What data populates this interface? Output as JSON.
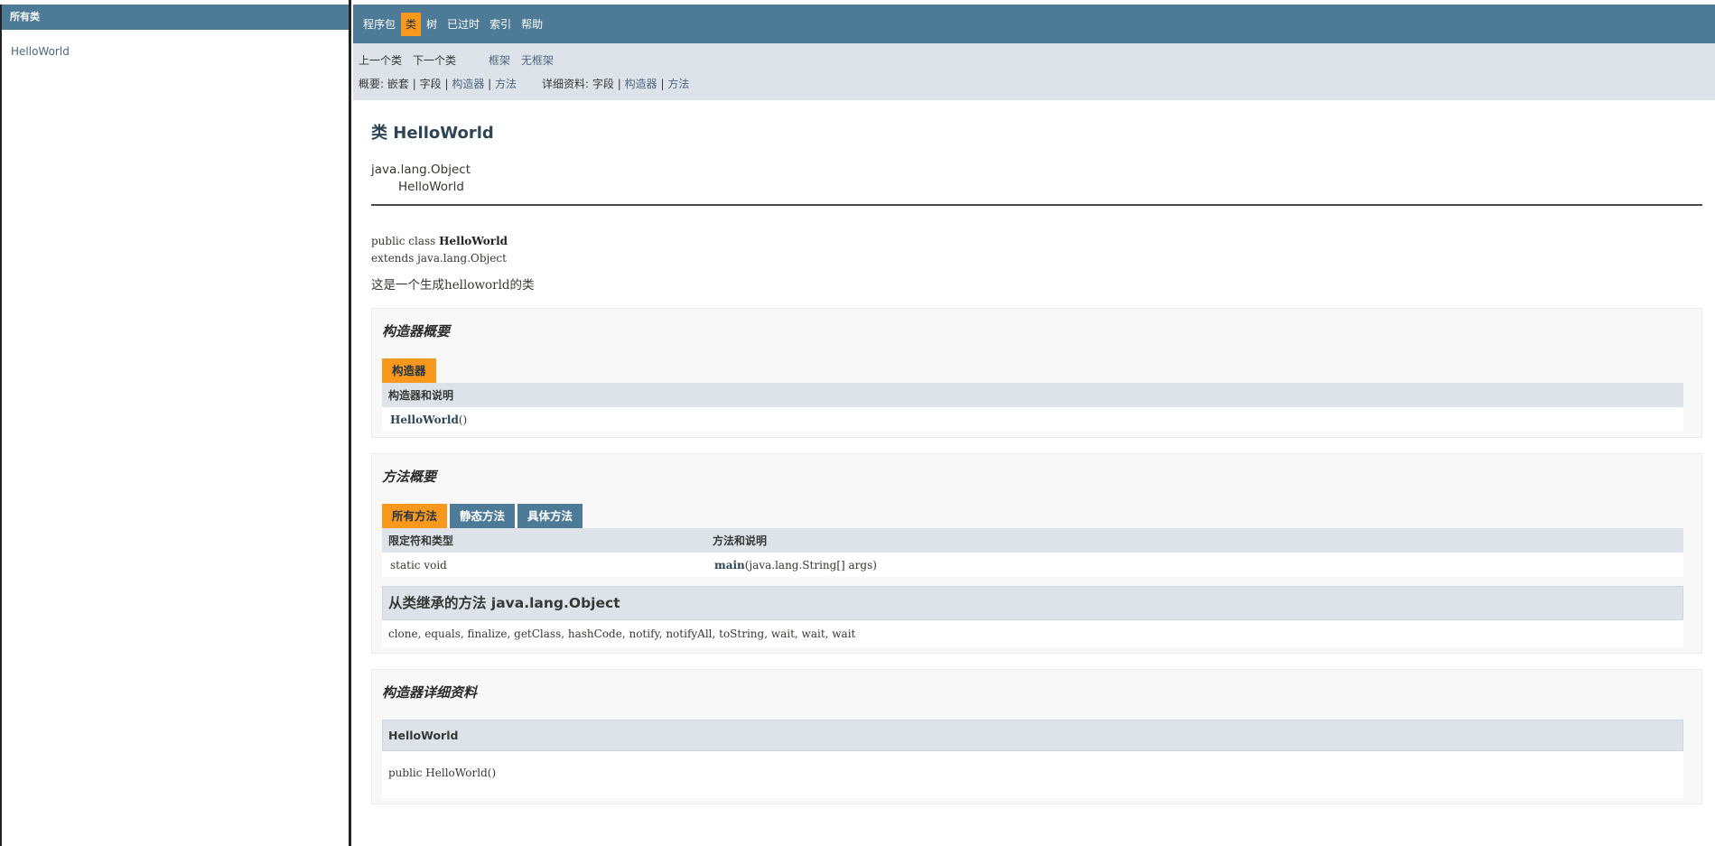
{
  "left": {
    "header": "所有类",
    "classes": [
      "HelloWorld"
    ]
  },
  "topnav": {
    "items": [
      "程序包",
      "类",
      "树",
      "已过时",
      "索引",
      "帮助"
    ],
    "active": "类"
  },
  "subnav": {
    "prev_class": "上一个类",
    "next_class": "下一个类",
    "frames": "框架",
    "no_frames": "无框架",
    "summary_label": "概要:",
    "summary_nested": "嵌套",
    "summary_field": "字段",
    "summary_constructor": "构造器",
    "summary_method": "方法",
    "detail_label": "详细资料:",
    "detail_field": "字段",
    "detail_constructor": "构造器",
    "detail_method": "方法",
    "sep": "|"
  },
  "class_title": "类 HelloWorld",
  "inheritance": {
    "parent": "java.lang.Object",
    "child": "HelloWorld"
  },
  "signature": {
    "line1_prefix": "public class ",
    "line1_name": "HelloWorld",
    "line2": "extends java.lang.Object"
  },
  "description": "这是一个生成helloworld的类",
  "constructor_summary": {
    "title": "构造器概要",
    "tab": "构造器",
    "header": "构造器和说明",
    "rows": [
      {
        "name": "HelloWorld",
        "params": "()"
      }
    ]
  },
  "method_summary": {
    "title": "方法概要",
    "tabs": [
      "所有方法",
      "静态方法",
      "具体方法"
    ],
    "active_tab": "所有方法",
    "headers": [
      "限定符和类型",
      "方法和说明"
    ],
    "rows": [
      {
        "modifier": "static void",
        "name": "main",
        "params": "(java.lang.String[]  args)"
      }
    ],
    "inherited_title": "从类继承的方法 java.lang.Object",
    "inherited_methods": "clone, equals, finalize, getClass, hashCode, notify, notifyAll, toString, wait, wait, wait"
  },
  "constructor_detail": {
    "title": "构造器详细资料",
    "name": "HelloWorld",
    "signature": "public  HelloWorld()"
  },
  "colors": {
    "nav_bg": "#4D7A97",
    "accent": "#F8981D",
    "subnav_bg": "#dee3e9",
    "link": "#4A6782"
  }
}
